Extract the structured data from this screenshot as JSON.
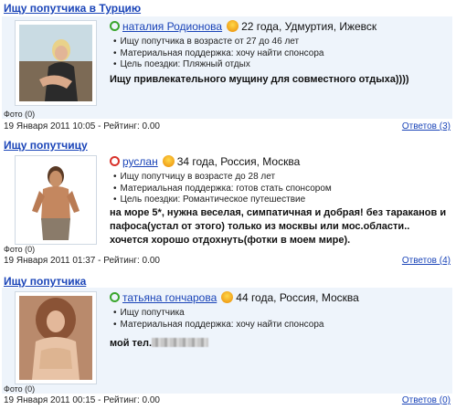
{
  "posts": [
    {
      "title": "Ищу попутчика в Турцию",
      "name": "наталия Родионова",
      "info": "22 года, Удмуртия, Ижевск",
      "status_icon": "online-green-icon",
      "zodiac_icon": "leo-sign-icon",
      "bullets": [
        "Ищу попутчика в возрасте от 27 до 46 лет",
        "Материальная поддержка: хочу найти спонсора",
        "Цель поездки: Пляжный отдых"
      ],
      "message": "Ищу привлекательного мущину для совместного отдыха))))",
      "photos": "Фото (0)",
      "meta": "19 Января 2011 10:05 - Рейтинг: 0.00",
      "answers": "Ответов (3)"
    },
    {
      "title": "Ищу попутчицу",
      "name": "руслан",
      "info": "34 года, Россия, Москва",
      "status_icon": "offline-red-icon",
      "zodiac_icon": "aries-sign-icon",
      "bullets": [
        "Ищу попутчицу в возрасте до 28 лет",
        "Материальная поддержка: готов стать спонсором",
        "Цель поездки: Романтическое путешествие"
      ],
      "message": "на море 5*, нужна веселая, симпатичная и добрая! без тараканов и пафоса(устал от этого) только из москвы или мос.области.. хочется хорошо отдохнуть(фотки в моем мире).",
      "photos": "Фото (0)",
      "meta": "19 Января 2011 01:37 - Рейтинг: 0.00",
      "answers": "Ответов (4)"
    },
    {
      "title": "Ищу попутчика",
      "name": "татьяна гончарова",
      "info": "44 года, Россия, Москва",
      "status_icon": "online-green-icon",
      "zodiac_icon": "leo-sign-icon",
      "bullets": [
        "Ищу попутчика",
        "Материальная поддержка: хочу найти спонсора"
      ],
      "message": "мой тел.",
      "photos": "Фото (0)",
      "meta": "19 Января 2011 00:15 - Рейтинг: 0.00",
      "answers": "Ответов (0)"
    }
  ],
  "colors": {
    "link": "#1a44b8",
    "card_bg": "#eef4fb",
    "online": "#3aa62d",
    "offline": "#d8322b"
  }
}
